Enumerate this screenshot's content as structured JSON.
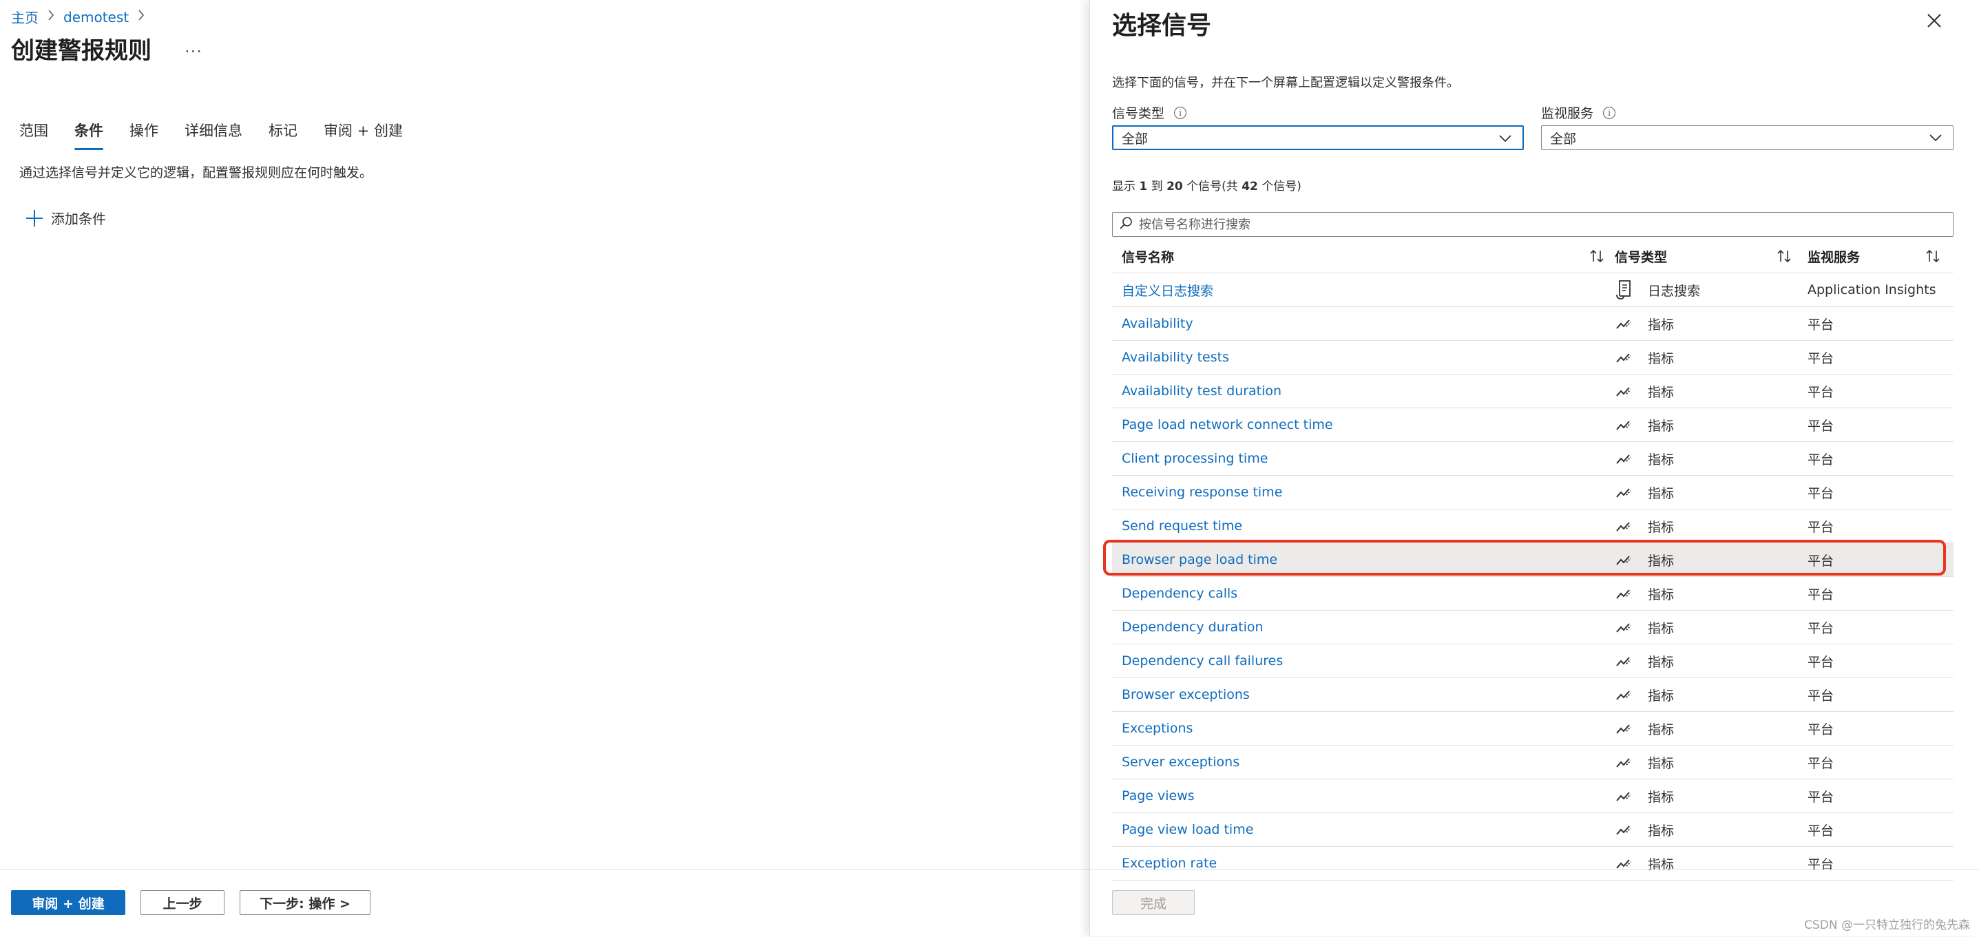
{
  "breadcrumb": {
    "home": "主页",
    "current": "demotest"
  },
  "page_title": "创建警报规则",
  "more_label": "...",
  "tabs": [
    {
      "label": "范围",
      "active": false
    },
    {
      "label": "条件",
      "active": true
    },
    {
      "label": "操作",
      "active": false
    },
    {
      "label": "详细信息",
      "active": false
    },
    {
      "label": "标记",
      "active": false
    },
    {
      "label": "审阅 + 创建",
      "active": false
    }
  ],
  "condition_intro": "通过选择信号并定义它的逻辑，配置警报规则应在何时触发。",
  "add_condition_label": "添加条件",
  "footer_left": {
    "review_create": "审阅 + 创建",
    "previous": "上一步",
    "next": "下一步: 操作 >"
  },
  "panel": {
    "title": "选择信号",
    "description": "选择下面的信号，并在下一个屏幕上配置逻辑以定义警报条件。",
    "signal_type_label": "信号类型",
    "signal_type_value": "全部",
    "monitor_service_label": "监视服务",
    "monitor_service_value": "全部",
    "count_parts": [
      "显示 ",
      "1",
      " 到 ",
      "20",
      " 个信号(共 ",
      "42",
      " 个信号)"
    ],
    "search_placeholder": "按信号名称进行搜索",
    "columns": {
      "name": "信号名称",
      "type": "信号类型",
      "service": "监视服务"
    },
    "rows": [
      {
        "name": "自定义日志搜索",
        "type": "日志搜索",
        "icon": "log-search-icon",
        "service": "Application Insights"
      },
      {
        "name": "Availability",
        "type": "指标",
        "icon": "metric-icon",
        "service": "平台"
      },
      {
        "name": "Availability tests",
        "type": "指标",
        "icon": "metric-icon",
        "service": "平台"
      },
      {
        "name": "Availability test duration",
        "type": "指标",
        "icon": "metric-icon",
        "service": "平台"
      },
      {
        "name": "Page load network connect time",
        "type": "指标",
        "icon": "metric-icon",
        "service": "平台"
      },
      {
        "name": "Client processing time",
        "type": "指标",
        "icon": "metric-icon",
        "service": "平台"
      },
      {
        "name": "Receiving response time",
        "type": "指标",
        "icon": "metric-icon",
        "service": "平台"
      },
      {
        "name": "Send request time",
        "type": "指标",
        "icon": "metric-icon",
        "service": "平台"
      },
      {
        "name": "Browser page load time",
        "type": "指标",
        "icon": "metric-icon",
        "service": "平台",
        "selected": true
      },
      {
        "name": "Dependency calls",
        "type": "指标",
        "icon": "metric-icon",
        "service": "平台"
      },
      {
        "name": "Dependency duration",
        "type": "指标",
        "icon": "metric-icon",
        "service": "平台"
      },
      {
        "name": "Dependency call failures",
        "type": "指标",
        "icon": "metric-icon",
        "service": "平台"
      },
      {
        "name": "Browser exceptions",
        "type": "指标",
        "icon": "metric-icon",
        "service": "平台"
      },
      {
        "name": "Exceptions",
        "type": "指标",
        "icon": "metric-icon",
        "service": "平台"
      },
      {
        "name": "Server exceptions",
        "type": "指标",
        "icon": "metric-icon",
        "service": "平台"
      },
      {
        "name": "Page views",
        "type": "指标",
        "icon": "metric-icon",
        "service": "平台"
      },
      {
        "name": "Page view load time",
        "type": "指标",
        "icon": "metric-icon",
        "service": "平台"
      },
      {
        "name": "Exception rate",
        "type": "指标",
        "icon": "metric-icon",
        "service": "平台"
      }
    ],
    "done_label": "完成"
  },
  "watermark": "CSDN @一只特立独行的兔先森",
  "colors": {
    "accent": "#0f6cbd",
    "highlight": "#e8351e",
    "selected_row": "#edebe9"
  }
}
